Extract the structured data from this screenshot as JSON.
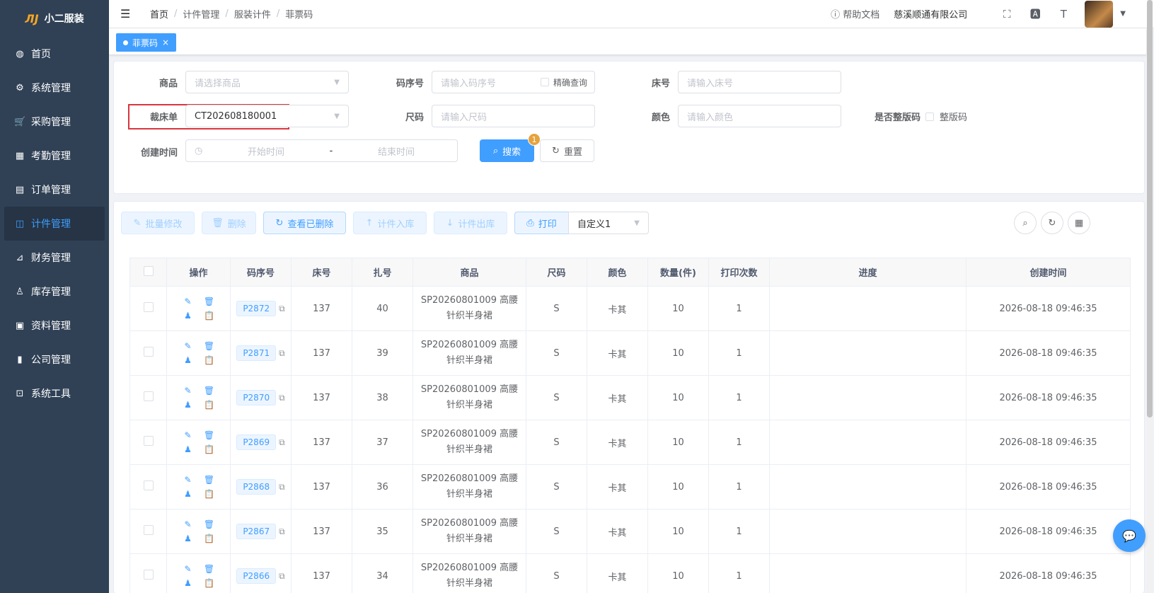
{
  "app": {
    "logo_mark": "ЛJ",
    "title": "小二服装"
  },
  "sidebar": {
    "items": [
      {
        "label": "首页",
        "icon": "dashboard-icon",
        "glyph": "◍",
        "active": false
      },
      {
        "label": "系统管理",
        "icon": "gear-icon",
        "glyph": "⚙",
        "active": false
      },
      {
        "label": "采购管理",
        "icon": "cart-icon",
        "glyph": "🛒",
        "active": false
      },
      {
        "label": "考勤管理",
        "icon": "grid-icon",
        "glyph": "▦",
        "active": false
      },
      {
        "label": "订单管理",
        "icon": "order-icon",
        "glyph": "▤",
        "active": false
      },
      {
        "label": "计件管理",
        "icon": "book-icon",
        "glyph": "◫",
        "active": true
      },
      {
        "label": "财务管理",
        "icon": "chart-icon",
        "glyph": "⊿",
        "active": false
      },
      {
        "label": "库存管理",
        "icon": "user-icon",
        "glyph": "♙",
        "active": false
      },
      {
        "label": "资料管理",
        "icon": "document-icon",
        "glyph": "▣",
        "active": false
      },
      {
        "label": "公司管理",
        "icon": "bar-chart-icon",
        "glyph": "▮",
        "active": false
      },
      {
        "label": "系统工具",
        "icon": "toolbox-icon",
        "glyph": "⊡",
        "active": false
      }
    ]
  },
  "header": {
    "breadcrumb": [
      "首页",
      "计件管理",
      "服装计件",
      "菲票码"
    ],
    "help": "帮助文档",
    "company": "慈溪顺通有限公司"
  },
  "tags": {
    "active": "菲票码"
  },
  "search": {
    "product_label": "商品",
    "product_placeholder": "请选择商品",
    "code_label": "码序号",
    "code_placeholder": "请输入码序号",
    "exact_label": "精确查询",
    "bed_label": "床号",
    "bed_placeholder": "请输入床号",
    "cut_label": "裁床单",
    "cut_value": "CT202608180001",
    "size_label": "尺码",
    "size_placeholder": "请输入尺码",
    "color_label": "颜色",
    "color_placeholder": "请输入颜色",
    "full_label": "是否整版码",
    "full_option": "整版码",
    "created_label": "创建时间",
    "start_placeholder": "开始时间",
    "range_sep": "-",
    "end_placeholder": "结束时间",
    "search_btn": "搜索",
    "reset_btn": "重置",
    "badge": "1"
  },
  "toolbar": {
    "batch_edit": "批量修改",
    "delete": "删除",
    "view_deleted": "查看已删除",
    "stock_in": "计件入库",
    "stock_out": "计件出库",
    "print": "打印",
    "template": "自定义1"
  },
  "table": {
    "columns": [
      "操作",
      "码序号",
      "床号",
      "扎号",
      "商品",
      "尺码",
      "颜色",
      "数量(件)",
      "打印次数",
      "进度",
      "创建时间"
    ],
    "rows": [
      {
        "code": "P2872",
        "bed": "137",
        "bundle": "40",
        "product_l1": "SP20260801009 高腰",
        "product_l2": "针织半身裙",
        "size": "S",
        "color": "卡其",
        "qty": "10",
        "prints": "1",
        "progress": "",
        "created": "2026-08-18 09:46:35"
      },
      {
        "code": "P2871",
        "bed": "137",
        "bundle": "39",
        "product_l1": "SP20260801009 高腰",
        "product_l2": "针织半身裙",
        "size": "S",
        "color": "卡其",
        "qty": "10",
        "prints": "1",
        "progress": "",
        "created": "2026-08-18 09:46:35"
      },
      {
        "code": "P2870",
        "bed": "137",
        "bundle": "38",
        "product_l1": "SP20260801009 高腰",
        "product_l2": "针织半身裙",
        "size": "S",
        "color": "卡其",
        "qty": "10",
        "prints": "1",
        "progress": "",
        "created": "2026-08-18 09:46:35"
      },
      {
        "code": "P2869",
        "bed": "137",
        "bundle": "37",
        "product_l1": "SP20260801009 高腰",
        "product_l2": "针织半身裙",
        "size": "S",
        "color": "卡其",
        "qty": "10",
        "prints": "1",
        "progress": "",
        "created": "2026-08-18 09:46:35"
      },
      {
        "code": "P2868",
        "bed": "137",
        "bundle": "36",
        "product_l1": "SP20260801009 高腰",
        "product_l2": "针织半身裙",
        "size": "S",
        "color": "卡其",
        "qty": "10",
        "prints": "1",
        "progress": "",
        "created": "2026-08-18 09:46:35"
      },
      {
        "code": "P2867",
        "bed": "137",
        "bundle": "35",
        "product_l1": "SP20260801009 高腰",
        "product_l2": "针织半身裙",
        "size": "S",
        "color": "卡其",
        "qty": "10",
        "prints": "1",
        "progress": "",
        "created": "2026-08-18 09:46:35"
      },
      {
        "code": "P2866",
        "bed": "137",
        "bundle": "34",
        "product_l1": "SP20260801009 高腰",
        "product_l2": "针织半身裙",
        "size": "S",
        "color": "卡其",
        "qty": "10",
        "prints": "1",
        "progress": "",
        "created": "2026-08-18 09:46:35"
      }
    ]
  },
  "colors": {
    "sidebar_bg": "#304156",
    "accent": "#409eff",
    "warning": "#e6a23c",
    "highlight": "#d9363e"
  }
}
